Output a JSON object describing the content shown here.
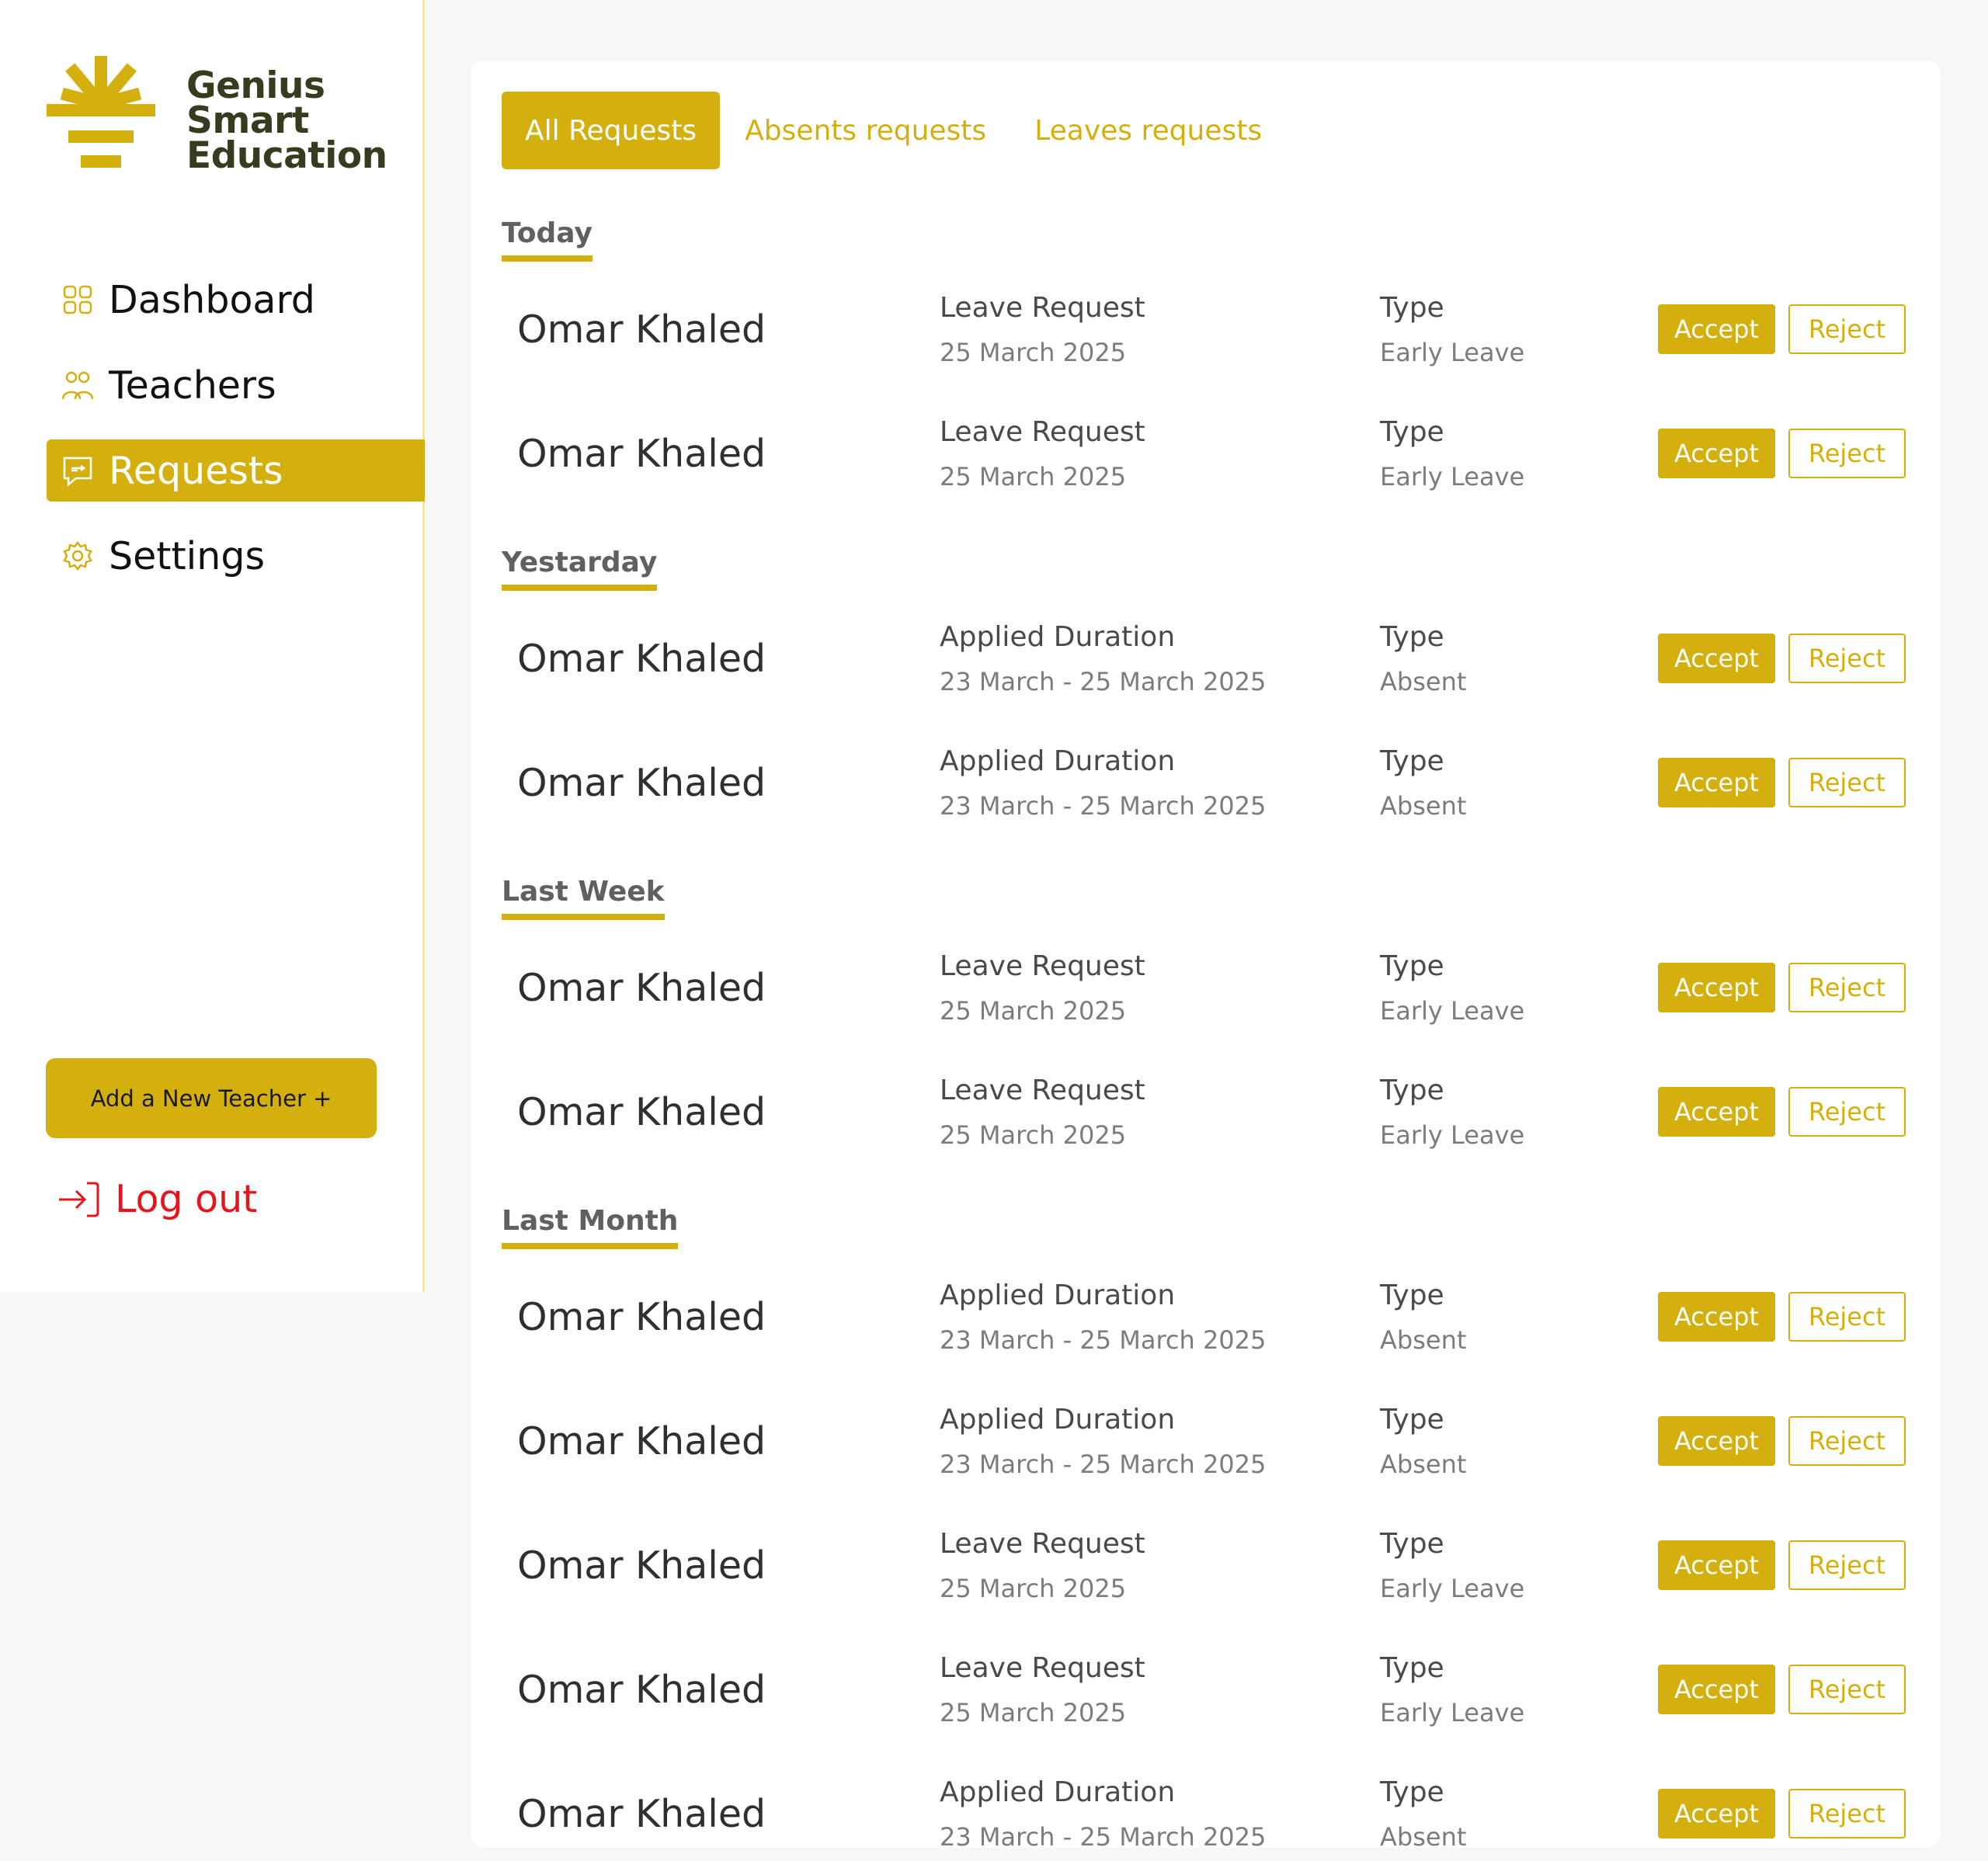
{
  "brand": {
    "lines": [
      "Genius",
      "Smart",
      "Education"
    ]
  },
  "colors": {
    "accent": "#d4b00e",
    "logo_text": "#3a3a1e",
    "logout": "#e8141b"
  },
  "sidebar": {
    "items": [
      {
        "label": "Dashboard",
        "icon": "grid-icon",
        "active": false
      },
      {
        "label": "Teachers",
        "icon": "users-icon",
        "active": false
      },
      {
        "label": "Requests",
        "icon": "chat-icon",
        "active": true
      },
      {
        "label": "Settings",
        "icon": "gear-icon",
        "active": false
      }
    ],
    "add_button": "Add a New Teacher +",
    "logout": "Log out"
  },
  "tabs": [
    {
      "label": "All Requests",
      "active": true
    },
    {
      "label": "Absents requests",
      "active": false
    },
    {
      "label": "Leaves requests",
      "active": false
    }
  ],
  "actions": {
    "accept": "Accept",
    "reject": "Reject"
  },
  "groups": [
    {
      "title": "Today",
      "rows": [
        {
          "name": "Omar Khaled",
          "info_title": "Leave Request",
          "info_value": "25 March 2025",
          "type_label": "Type",
          "type_value": "Early Leave"
        },
        {
          "name": "Omar Khaled",
          "info_title": "Leave Request",
          "info_value": "25 March 2025",
          "type_label": "Type",
          "type_value": "Early Leave"
        }
      ]
    },
    {
      "title": "Yestarday",
      "rows": [
        {
          "name": "Omar Khaled",
          "info_title": "Applied Duration",
          "info_value": "23 March - 25 March 2025",
          "type_label": "Type",
          "type_value": "Absent"
        },
        {
          "name": "Omar Khaled",
          "info_title": "Applied Duration",
          "info_value": "23 March - 25 March 2025",
          "type_label": "Type",
          "type_value": "Absent"
        }
      ]
    },
    {
      "title": "Last Week",
      "rows": [
        {
          "name": "Omar Khaled",
          "info_title": "Leave Request",
          "info_value": "25 March 2025",
          "type_label": "Type",
          "type_value": "Early Leave"
        },
        {
          "name": "Omar Khaled",
          "info_title": "Leave Request",
          "info_value": "25 March 2025",
          "type_label": "Type",
          "type_value": "Early Leave"
        }
      ]
    },
    {
      "title": "Last Month",
      "rows": [
        {
          "name": "Omar Khaled",
          "info_title": "Applied Duration",
          "info_value": "23 March - 25 March 2025",
          "type_label": "Type",
          "type_value": "Absent"
        },
        {
          "name": "Omar Khaled",
          "info_title": "Applied Duration",
          "info_value": "23 March - 25 March 2025",
          "type_label": "Type",
          "type_value": "Absent"
        },
        {
          "name": "Omar Khaled",
          "info_title": "Leave Request",
          "info_value": "25 March 2025",
          "type_label": "Type",
          "type_value": "Early Leave"
        },
        {
          "name": "Omar Khaled",
          "info_title": "Leave Request",
          "info_value": "25 March 2025",
          "type_label": "Type",
          "type_value": "Early Leave"
        },
        {
          "name": "Omar Khaled",
          "info_title": "Applied Duration",
          "info_value": "23 March - 25 March 2025",
          "type_label": "Type",
          "type_value": "Absent"
        }
      ]
    }
  ]
}
